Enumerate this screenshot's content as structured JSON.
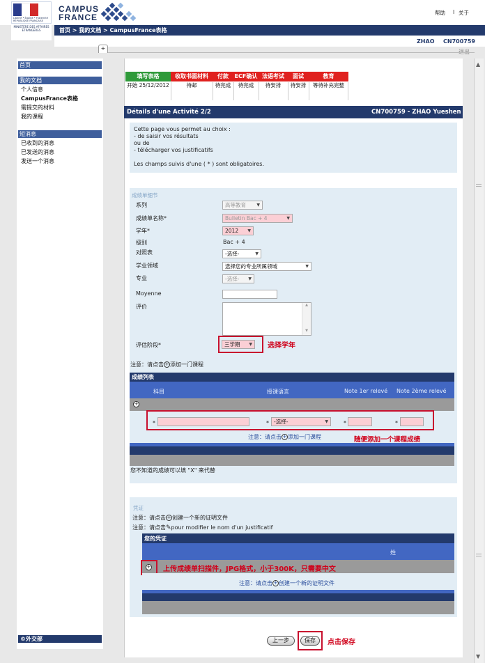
{
  "header": {
    "flag_caption": "Liberté • Égalité • Fraternité RÉPUBLIQUE FRANÇAISE",
    "ministry": "MINISTÈRE DES AFFAIRES ÉTRANGÈRES",
    "logo_line1": "CAMPUS",
    "logo_line2": "FRANCE",
    "help": "帮助",
    "separator": "I",
    "about": "关于"
  },
  "breadcrumb": "首页 > 我的文档 > CampusFrance表格",
  "user": {
    "name": "ZHAO",
    "id": "CN700759",
    "logout": "退出"
  },
  "tab_plus": "+",
  "sidebar": {
    "home": "首页",
    "docs_head": "我的文档",
    "docs_items": [
      "个人信息",
      "CampusFrance表格",
      "需提交的材料",
      "我的课程"
    ],
    "msg_head": "短消息",
    "msg_items": [
      "已收到的消息",
      "已发送的消息",
      "发送一个消息"
    ],
    "footer": "©外交部"
  },
  "steps": {
    "labels": [
      "填写表格",
      "收取书面材料",
      "付款",
      "ECF确认",
      "法语考试",
      "面试",
      "教育"
    ],
    "values": [
      "开始 25/12/2012",
      "待邮",
      "待完成",
      "待完成",
      "待安排",
      "待安排",
      "等待补充完整"
    ],
    "colors": {
      "active": "#2f9a3a",
      "pending": "#e0211f"
    }
  },
  "activity": {
    "title": "Détails d'une Activité 2/2",
    "user": "CN700759 - ZHAO Yueshen"
  },
  "info": {
    "line1": "Cette page vous permet au choix :",
    "line2": "- de saisir vos résultats",
    "line3": "ou de",
    "line4": "- télécharger vos justificatifs",
    "line5": "Les champs suivis d'une ( * ) sont obligatoires."
  },
  "form": {
    "legend": "成绩单细节",
    "series_label": "系列",
    "series_value": "高等教育",
    "bulletin_label": "成绩单名称*",
    "bulletin_value": "Bulletin Bac + 4",
    "year_label": "学年*",
    "year_value": "2012",
    "level_label": "级别",
    "level_value": "Bac + 4",
    "table_label": "对照表",
    "table_value": "-选择-",
    "field_label": "学业领域",
    "field_value": "选择您的专业所属领域",
    "major_label": "专业",
    "major_value": "-选择-",
    "avg_label": "Moyenne",
    "comment_label": "评价",
    "stage_label": "评估阶段*",
    "stage_value": "三学期",
    "stage_annotation": "选择学年"
  },
  "add_course_note": "注意：请点击",
  "add_course_link": "添加一门课程",
  "grades": {
    "head": "成绩列表",
    "columns": [
      "科目",
      "授课语言",
      "Note 1er relevé",
      "Note 2ème relevé"
    ],
    "row_lang_value": "-选择-",
    "row_note_prefix": "注意：请点击",
    "row_note_link": "添加一门课程",
    "row_annotation": "随便添加一个课程成绩",
    "unknown_note": "您不知道的成绩可以填 \"X\" 来代替"
  },
  "proof": {
    "legend": "凭证",
    "note1_prefix": "注意：请点击",
    "note1_link": "创建一个新的证明文件",
    "note2_prefix": "注意：请点击",
    "note2_link": "pour modifier le nom d'un justificatif",
    "head": "您的凭证",
    "col_name": "姓",
    "upload_annotation": "上传成绩单扫描件，JPG格式，小于300K，只需要中文",
    "row_note_prefix": "注意：请点击",
    "row_note_link": "创建一个新的证明文件"
  },
  "buttons": {
    "prev": "上一步",
    "save": "保存",
    "save_annotation": "点击保存"
  },
  "star": "*",
  "icons": [
    "plus-circle-icon",
    "pencil-icon",
    "dropdown-arrow-icon",
    "scroll-up-icon",
    "scroll-down-icon"
  ]
}
